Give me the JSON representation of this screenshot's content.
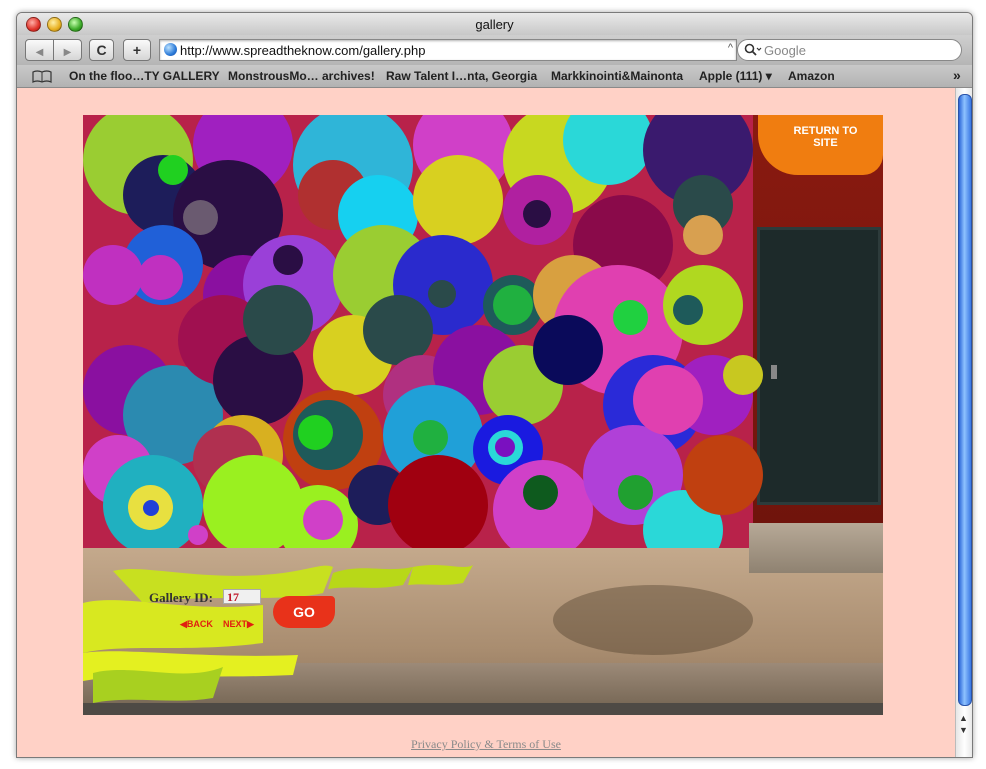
{
  "window": {
    "title": "gallery"
  },
  "toolbar": {
    "url": "http://www.spreadtheknow.com/gallery.php",
    "search_placeholder": "Google",
    "back_label": "◀",
    "forward_label": "▶",
    "reload_label": "C",
    "add_label": "+"
  },
  "bookmarks": [
    {
      "label": "On the floo…TY GALLERY"
    },
    {
      "label": "MonstrousMo… archives!"
    },
    {
      "label": "Raw Talent I…nta, Georgia"
    },
    {
      "label": "Markkinointi&Mainonta"
    },
    {
      "label": "Apple (111) ▾"
    },
    {
      "label": "Amazon"
    }
  ],
  "page": {
    "return_label": "RETURN TO SITE",
    "gallery_id_label": "Gallery ID:",
    "gallery_id_value": "17",
    "go_label": "GO",
    "back_link": "BACK",
    "next_link": "NEXT",
    "footer_link": "Privacy Policy & Terms of Use"
  },
  "icons": {
    "bookmarks_book": "book-icon",
    "globe": "globe-icon",
    "search": "magnifier-icon"
  },
  "colors": {
    "page_bg": "#ffd1c6",
    "return_button": "#f07d10",
    "go_button": "#e8321a"
  }
}
